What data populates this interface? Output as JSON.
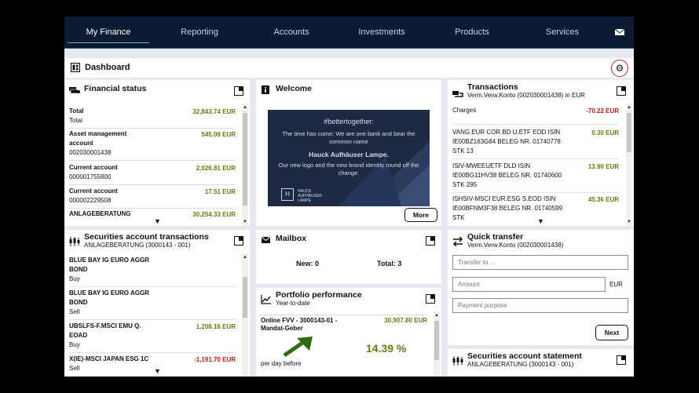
{
  "nav": {
    "items": [
      "My Finance",
      "Reporting",
      "Accounts",
      "Investments",
      "Products",
      "Services"
    ],
    "active": "My Finance",
    "mail_icon": "envelope-icon"
  },
  "dashboard": {
    "title": "Dashboard",
    "settings_icon": "gear-icon"
  },
  "financial_status": {
    "title": "Financial status",
    "rows": [
      {
        "label": "Total",
        "sub": "Total",
        "amount": "32,843.74 EUR"
      },
      {
        "label": "Asset management account",
        "sub": "002030001438",
        "amount": "545.09 EUR"
      },
      {
        "label": "Current account",
        "sub": "000001755800",
        "amount": "2,026.81 EUR"
      },
      {
        "label": "Current account",
        "sub": "000002229508",
        "amount": "17.51 EUR"
      },
      {
        "label": "ANLAGEBERATUNG",
        "sub": "",
        "amount": "30,254.33 EUR"
      }
    ]
  },
  "welcome": {
    "title": "Welcome",
    "hashtag": "#bettertogether:",
    "text1": "The time has come: We are one bank and bear the common name",
    "brand": "Hauck Aufhäuser Lampe.",
    "text2": "Our new logo and the new brand identity round off the change.",
    "logo_letter": "H",
    "logo_text": "HAUCK AUFHÄUSER LAMPE",
    "more": "More"
  },
  "transactions": {
    "title": "Transactions",
    "subtitle": "Verm.Verw.Konto (002030001438) in EUR",
    "rows": [
      {
        "text": "Charges",
        "amount": "-70.22 EUR",
        "color": "red"
      },
      {
        "text": "VANG.EUR COR.BD U.ETF EOD ISIN IE00BZ163G84 BELEG NR. 01740778 STK 13",
        "amount": "0.30 EUR",
        "color": "green"
      },
      {
        "text": "ISIV-MWEEUETF DLD ISIN IE00BG11HV38 BELEG NR. 01740600 STK 295",
        "amount": "13.90 EUR",
        "color": "green"
      },
      {
        "text": "ISHSIV-MSCI EUR.ESG S.EOD ISIN IE00BFNM3F38 BELEG NR. 01740599 STK",
        "amount": "45.36 EUR",
        "color": "green"
      }
    ]
  },
  "securities_tx": {
    "title": "Securities account transactions",
    "subtitle": "ANLAGEBERATUNG (3000143 - 001)",
    "rows": [
      {
        "name": "BLUE BAY IG EURO AGGR BOND",
        "type": "Buy",
        "amount": ""
      },
      {
        "name": "BLUE BAY IG EURO AGGR BOND",
        "type": "Sell",
        "amount": ""
      },
      {
        "name": "UBSLFS-F.MSCI EMU Q. EOAD",
        "type": "Buy",
        "amount": "1,208.16 EUR"
      },
      {
        "name": "X(IE)-MSCI JAPAN ESG 1C",
        "type": "Sell",
        "amount": "-1,191.70 EUR"
      }
    ]
  },
  "mailbox": {
    "title": "Mailbox",
    "new_label": "New: 0",
    "total_label": "Total: 3"
  },
  "portfolio": {
    "title": "Portfolio performance",
    "subtitle": "Year-to-date",
    "account": "Online FVV - 3000143-01 - Mandat-Geber",
    "amount": "30,907.80 EUR",
    "percent": "14.39 %",
    "per_day": "per day before"
  },
  "quick_transfer": {
    "title": "Quick transfer",
    "subtitle": "Verm.Verw.Konto (002030001438)",
    "transfer_to_placeholder": "Transfer to ...",
    "amount_placeholder": "Amount",
    "currency": "EUR",
    "purpose_placeholder": "Payment purpose",
    "next": "Next"
  },
  "statement": {
    "title": "Securities account statement",
    "subtitle": "ANLAGEBERATUNG (3000143 - 001)"
  }
}
